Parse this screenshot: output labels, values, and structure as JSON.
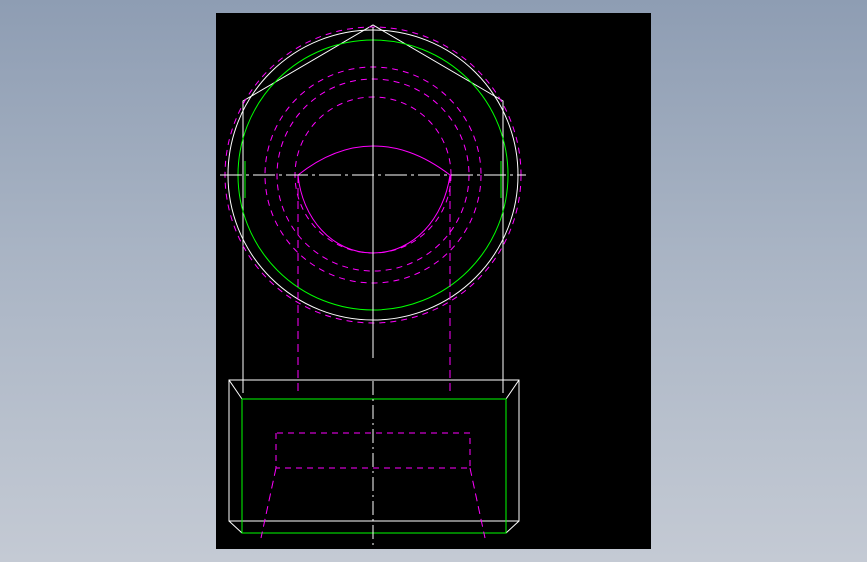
{
  "canvas": {
    "background": "#000000",
    "page_background": "#a3afc0"
  },
  "colors": {
    "outline": "#ffffff",
    "visible_edge": "#00ff00",
    "hidden_edge": "#ff00ff",
    "center_line": "#ffffff"
  },
  "drawing": {
    "views": [
      "end-view-hexagon-with-threaded-bore",
      "side-view-base-block"
    ],
    "line_types": [
      "solid",
      "dashed-hidden",
      "dash-dot-centerline"
    ]
  }
}
